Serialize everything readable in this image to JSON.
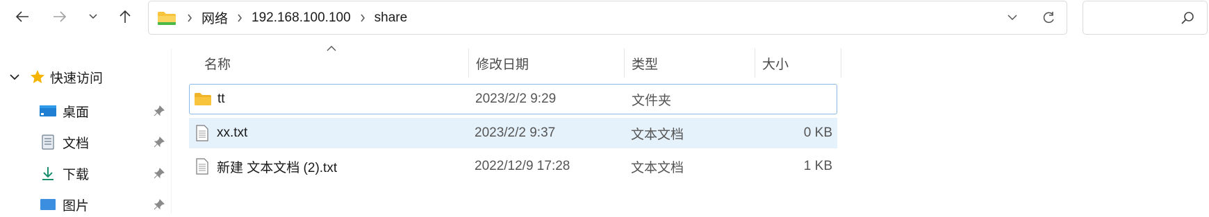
{
  "nav": {
    "back_icon": "arrow-left-icon",
    "forward_icon": "arrow-right-icon",
    "recent_icon": "chevron-down-icon",
    "up_icon": "arrow-up-icon"
  },
  "address": {
    "folder_icon": "folder-icon",
    "crumbs": [
      "网络",
      "192.168.100.100",
      "share"
    ],
    "dropdown_icon": "chevron-down-icon",
    "refresh_icon": "refresh-icon"
  },
  "search": {
    "placeholder": "",
    "icon": "search-icon"
  },
  "sidebar": {
    "quick_access": {
      "label": "快速访问",
      "icon": "star-icon",
      "expand_icon": "chevron-down-icon"
    },
    "items": [
      {
        "label": "桌面",
        "icon": "desktop-icon",
        "pinned": true
      },
      {
        "label": "文档",
        "icon": "document-icon",
        "pinned": true
      },
      {
        "label": "下载",
        "icon": "download-icon",
        "pinned": true
      },
      {
        "label": "图片",
        "icon": "picture-icon",
        "pinned": true
      }
    ]
  },
  "columns": {
    "name": "名称",
    "modified": "修改日期",
    "type": "类型",
    "size": "大小",
    "sort_icon": "sort-ascending-icon"
  },
  "files": [
    {
      "name": "tt",
      "modified": "2023/2/2 9:29",
      "type": "文件夹",
      "size": "",
      "icon": "folder-icon",
      "state": "focused"
    },
    {
      "name": "xx.txt",
      "modified": "2023/2/2 9:37",
      "type": "文本文档",
      "size": "0 KB",
      "icon": "text-file-icon",
      "state": "selected"
    },
    {
      "name": "新建 文本文档 (2).txt",
      "modified": "2022/12/9 17:28",
      "type": "文本文档",
      "size": "1 KB",
      "icon": "text-file-icon",
      "state": "normal"
    }
  ],
  "colors": {
    "accent": "#0067c0",
    "selection": "#e5f1fb",
    "focus_border": "#8bb8e8",
    "folder": "#f8c43b"
  }
}
